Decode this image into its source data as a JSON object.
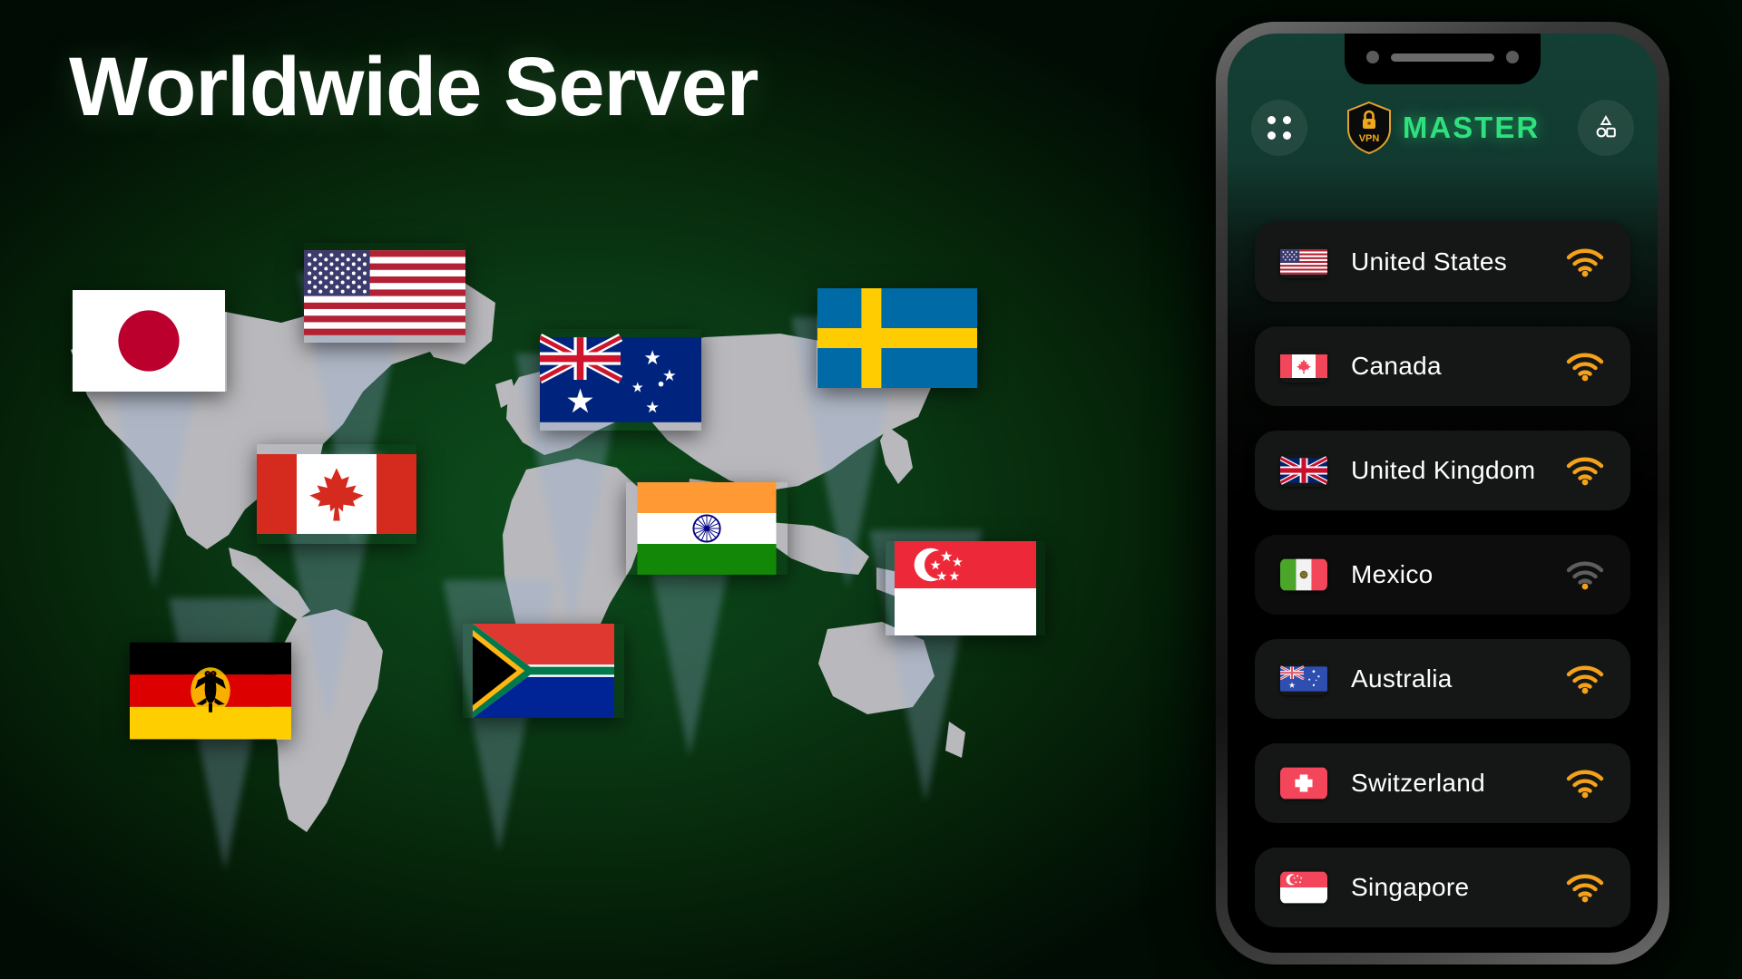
{
  "headline": "Worldwide Server",
  "colors": {
    "bg_green": "#0d4d1c",
    "accent_green": "#2ee07e",
    "signal_orange": "#f5a21a",
    "card_dark": "#141715",
    "card_dim": "#0c0d0c",
    "gold": "#e0a32e"
  },
  "phone": {
    "header": {
      "menu_icon": "grid-dots-icon",
      "logo": {
        "badge_text": "VPN",
        "badge_icon": "padlock-icon",
        "wordmark": "MASTER"
      },
      "right_icon": "shapes-icon"
    },
    "servers": [
      {
        "name": "United States",
        "flag": "us",
        "signal": "strong",
        "signal_icon": "wifi-icon"
      },
      {
        "name": "Canada",
        "flag": "ca",
        "signal": "strong",
        "signal_icon": "wifi-icon"
      },
      {
        "name": "United Kingdom",
        "flag": "gb",
        "signal": "strong",
        "signal_icon": "wifi-icon"
      },
      {
        "name": "Mexico",
        "flag": "mx",
        "signal": "weak",
        "signal_icon": "wifi-icon"
      },
      {
        "name": "Australia",
        "flag": "au",
        "signal": "strong",
        "signal_icon": "wifi-icon"
      },
      {
        "name": "Switzerland",
        "flag": "ch",
        "signal": "strong",
        "signal_icon": "wifi-icon"
      },
      {
        "name": "Singapore",
        "flag": "sg",
        "signal": "strong",
        "signal_icon": "wifi-icon"
      }
    ]
  },
  "map_flags": [
    {
      "country": "Japan",
      "flag": "jp"
    },
    {
      "country": "United States",
      "flag": "us"
    },
    {
      "country": "Australia",
      "flag": "au"
    },
    {
      "country": "Sweden",
      "flag": "se"
    },
    {
      "country": "Canada",
      "flag": "ca"
    },
    {
      "country": "India",
      "flag": "in"
    },
    {
      "country": "Singapore",
      "flag": "sg"
    },
    {
      "country": "Germany",
      "flag": "de"
    },
    {
      "country": "South Africa",
      "flag": "za"
    }
  ]
}
